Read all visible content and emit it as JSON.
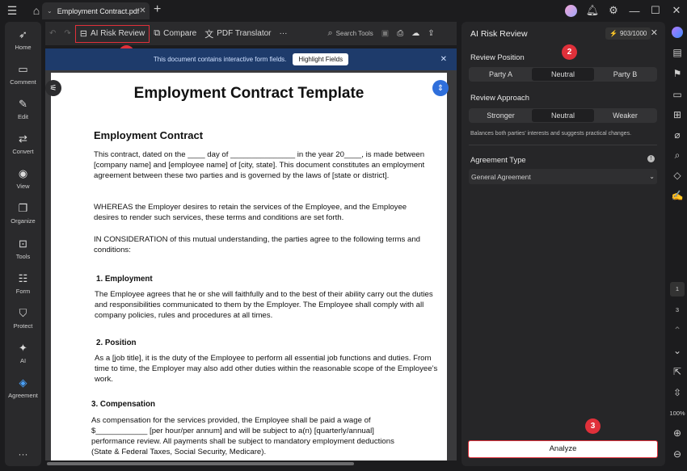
{
  "window": {
    "tab_title": "Employment Contract.pdf",
    "new_tab": "+",
    "menu_icon": "☰",
    "home_icon": "⌂"
  },
  "titlebar_right": [
    "bell-icon",
    "gear-icon",
    "minimize",
    "maximize",
    "close"
  ],
  "toolbar": {
    "ai_risk_review": "AI Risk Review",
    "compare": "Compare",
    "pdf_translator": "PDF Translator",
    "more": "···",
    "search_tools": "Search Tools"
  },
  "left_nav": [
    {
      "label": "Home",
      "icon": "rocket-icon"
    },
    {
      "label": "Comment",
      "icon": "comment-icon"
    },
    {
      "label": "Edit",
      "icon": "edit-icon"
    },
    {
      "label": "Convert",
      "icon": "convert-icon"
    },
    {
      "label": "View",
      "icon": "eye-icon"
    },
    {
      "label": "Organize",
      "icon": "organize-icon"
    },
    {
      "label": "Tools",
      "icon": "toolbox-icon"
    },
    {
      "label": "Form",
      "icon": "form-icon"
    },
    {
      "label": "Protect",
      "icon": "shield-icon"
    },
    {
      "label": "AI",
      "icon": "ai-icon"
    },
    {
      "label": "Agreement",
      "icon": "agreement-icon"
    }
  ],
  "notice": {
    "text": "This document contains interactive form fields.",
    "button": "Highlight Fields"
  },
  "document": {
    "title": "Employment Contract Template",
    "heading": "Employment Contract",
    "para1": "This contract, dated on the ____ day of _______________ in the year 20____, is made between [company name] and [employee name] of [city, state]. This document constitutes an employment agreement between these two parties and is governed by the laws of [state or district].",
    "para2": "WHEREAS the Employer desires to retain the services of the Employee, and the Employee desires to render such services, these terms and conditions are set forth.",
    "para3": "IN CONSIDERATION of this mutual understanding, the parties agree to the following terms and conditions:",
    "s1_title": "1.   Employment",
    "s1_text": "The Employee agrees that he or she will faithfully and to the best of their ability carry out the duties and responsibilities communicated to them by the Employer. The Employee shall comply with all company policies, rules and procedures at all times.",
    "s2_title": "2.   Position",
    "s2_text": "As a [job title], it is the duty of the Employee to perform all essential job functions and duties. From time to time, the Employer may also add other duties within the reasonable scope of the Employee’s work.",
    "s3_title": "3.   Compensation",
    "s3_text": "As compensation for the services provided, the Employee shall be paid a wage of $____________ [per hour/per annum] and will be subject to a(n) [quarterly/annual] performance review. All payments shall be subject to mandatory employment deductions (State & Federal Taxes, Social Security, Medicare)."
  },
  "panel": {
    "title": "AI Risk Review",
    "credits": "903/1000",
    "review_position_label": "Review Position",
    "positions": [
      "Party A",
      "Neutral",
      "Party B"
    ],
    "review_approach_label": "Review Approach",
    "approaches": [
      "Stronger",
      "Neutral",
      "Weaker"
    ],
    "note": "Balances both parties' interests and suggests practical changes.",
    "agreement_type_label": "Agreement Type",
    "agreement_type_value": "General Agreement",
    "analyze": "Analyze"
  },
  "badges": [
    "1",
    "2",
    "3"
  ],
  "right_rail": {
    "page_current": "1",
    "page_total": "3",
    "zoom": "100%"
  },
  "colors": {
    "accent_red": "#e0303a",
    "notice_bg": "#1e3b6b",
    "selected_blue": "#4aa3ff"
  }
}
